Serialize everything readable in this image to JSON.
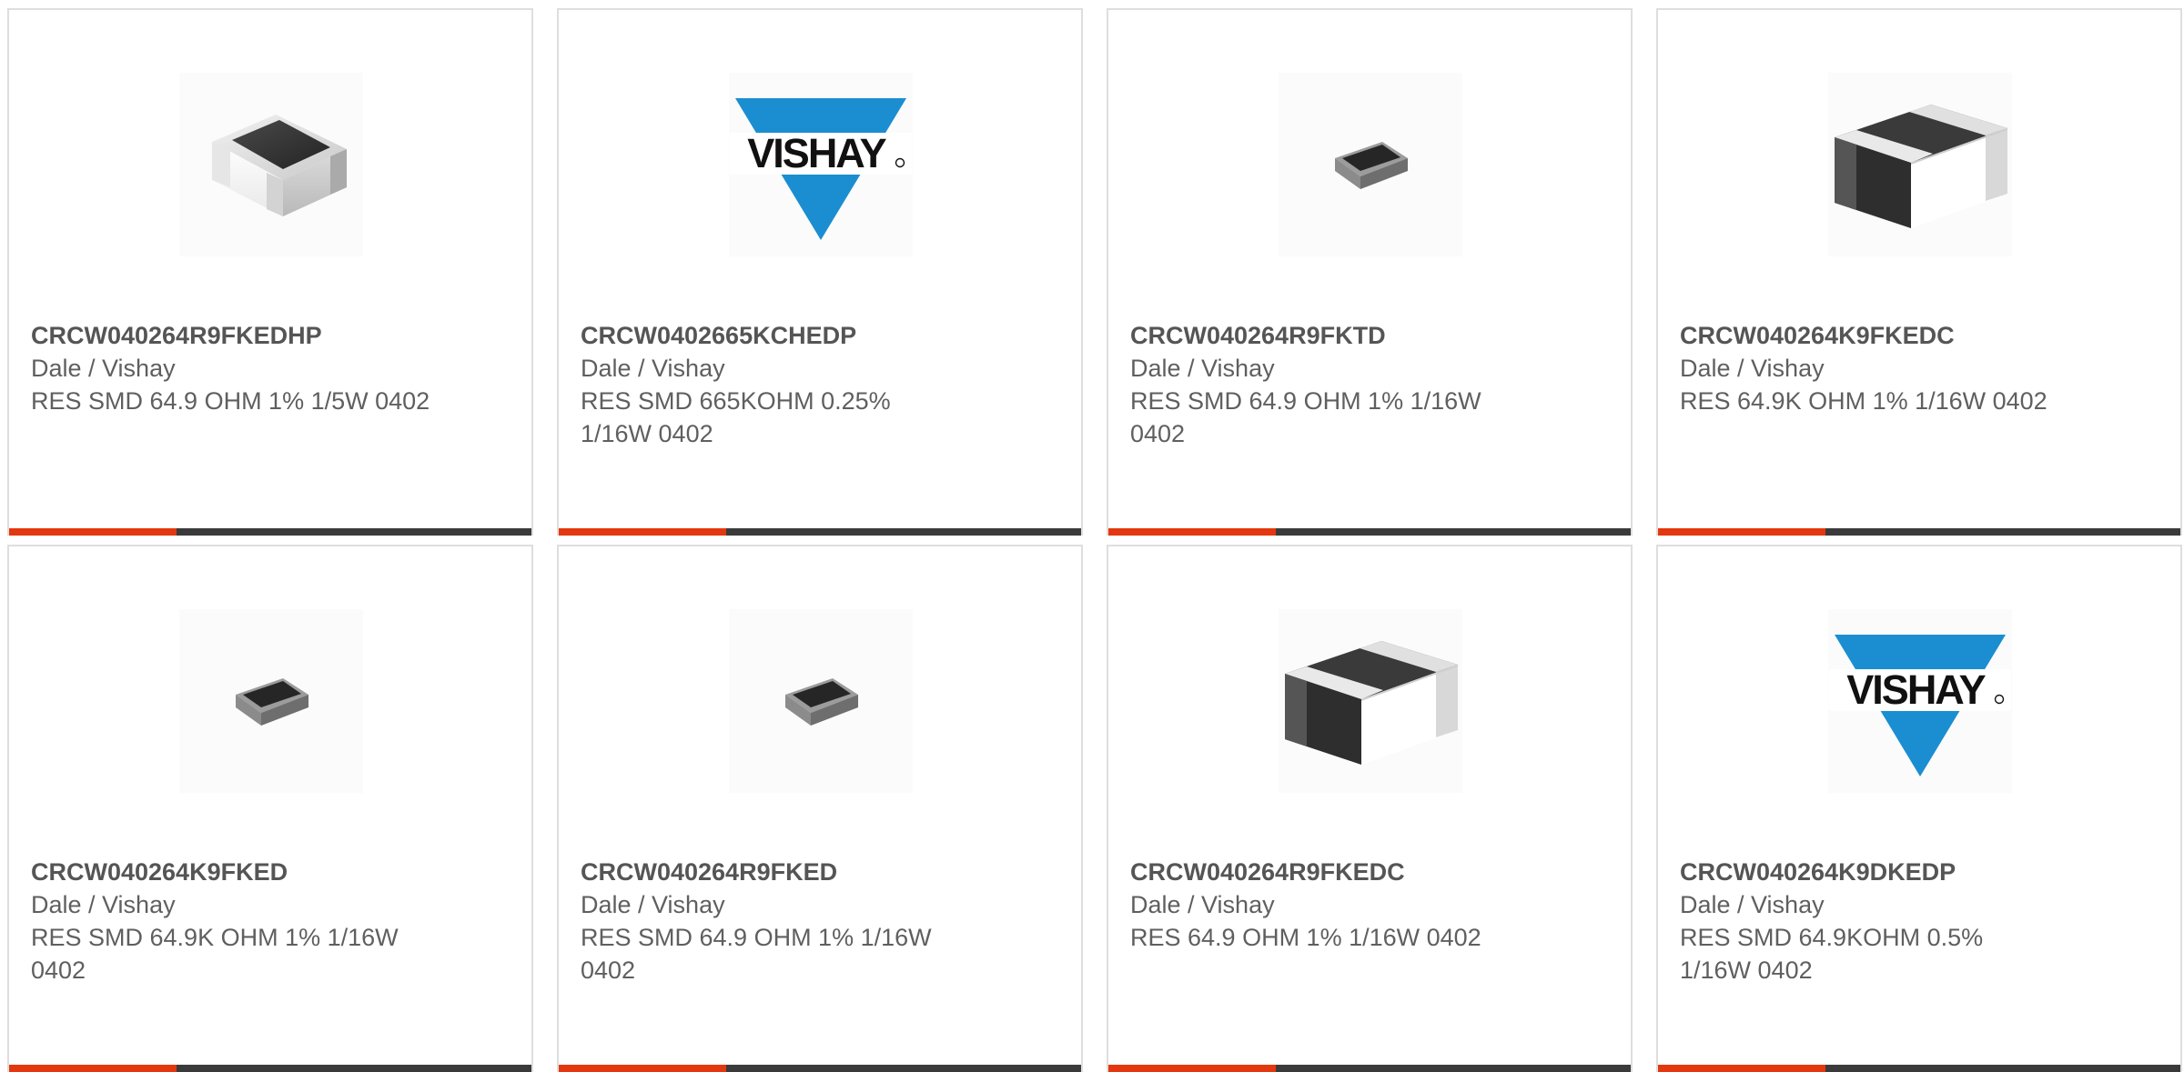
{
  "colors": {
    "accent": "#e3370f",
    "bar_dark": "#3a3a3a",
    "title_text": "#555555",
    "body_text": "#5f5f5f",
    "card_border": "#dedede",
    "vishay_blue": "#1a8ed1"
  },
  "products": [
    {
      "part_number": "CRCW040264R9FKEDHP",
      "manufacturer": "Dale / Vishay",
      "description": "RES SMD 64.9 OHM 1% 1/5W 0402",
      "image": "resistor-chip-light-icon"
    },
    {
      "part_number": "CRCW0402665KCHEDP",
      "manufacturer": "Dale / Vishay",
      "description": "RES SMD 665KOHM 0.25% 1/16W 0402",
      "image": "vishay-logo"
    },
    {
      "part_number": "CRCW040264R9FKTD",
      "manufacturer": "Dale / Vishay",
      "description": "RES SMD 64.9 OHM 1% 1/16W 0402",
      "image": "resistor-chip-small-icon"
    },
    {
      "part_number": "CRCW040264K9FKEDC",
      "manufacturer": "Dale / Vishay",
      "description": "RES 64.9K OHM 1% 1/16W 0402",
      "image": "resistor-chip-dark-icon"
    },
    {
      "part_number": "CRCW040264K9FKED",
      "manufacturer": "Dale / Vishay",
      "description": "RES SMD 64.9K OHM 1% 1/16W 0402",
      "image": "resistor-chip-small-icon"
    },
    {
      "part_number": "CRCW040264R9FKED",
      "manufacturer": "Dale / Vishay",
      "description": "RES SMD 64.9 OHM 1% 1/16W 0402",
      "image": "resistor-chip-small-icon"
    },
    {
      "part_number": "CRCW040264R9FKEDC",
      "manufacturer": "Dale / Vishay",
      "description": "RES 64.9 OHM 1% 1/16W 0402",
      "image": "resistor-chip-dark-icon"
    },
    {
      "part_number": "CRCW040264K9DKEDP",
      "manufacturer": "Dale / Vishay",
      "description": "RES SMD 64.9KOHM 0.5% 1/16W 0402",
      "image": "vishay-logo"
    }
  ]
}
